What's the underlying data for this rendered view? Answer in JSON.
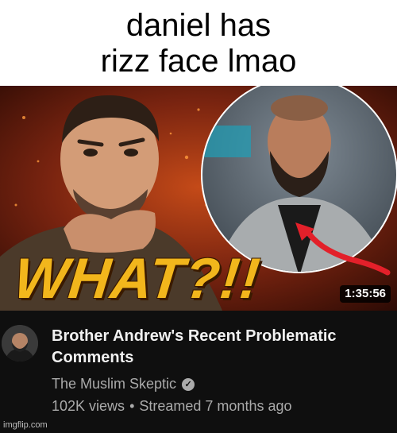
{
  "caption": {
    "line1": "daniel has",
    "line2": "rizz face lmao"
  },
  "thumbnail": {
    "overlay_text": "WHAT?!!",
    "duration": "1:35:56"
  },
  "video": {
    "title_line1": "Brother Andrew's Recent Problematic",
    "title_line2": "Comments",
    "channel": "The Muslim Skeptic",
    "views": "102K views",
    "separator": "•",
    "streamed": "Streamed 7 months ago"
  },
  "watermark": "imgflip.com",
  "colors": {
    "overlay_text": "#f2b61c",
    "arrow": "#e3202a",
    "meta_bg": "#0f0f0f",
    "thumb_bg": "#6a1c0c"
  },
  "icons": {
    "verified": "check-circle-icon"
  }
}
